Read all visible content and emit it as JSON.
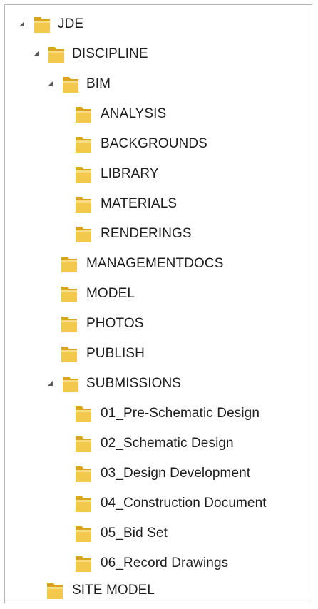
{
  "tree": {
    "items": [
      {
        "label": "JDE",
        "expanded": true,
        "icon": "folder-icon"
      },
      {
        "label": "DISCIPLINE",
        "expanded": true,
        "icon": "folder-icon"
      },
      {
        "label": "BIM",
        "expanded": true,
        "icon": "folder-icon"
      },
      {
        "label": "ANALYSIS",
        "icon": "folder-icon"
      },
      {
        "label": "BACKGROUNDS",
        "icon": "folder-icon"
      },
      {
        "label": "LIBRARY",
        "icon": "folder-icon"
      },
      {
        "label": "MATERIALS",
        "icon": "folder-icon"
      },
      {
        "label": "RENDERINGS",
        "icon": "folder-icon"
      },
      {
        "label": "MANAGEMENTDOCS",
        "icon": "folder-icon"
      },
      {
        "label": "MODEL",
        "icon": "folder-icon"
      },
      {
        "label": "PHOTOS",
        "icon": "folder-icon"
      },
      {
        "label": "PUBLISH",
        "icon": "folder-icon"
      },
      {
        "label": "SUBMISSIONS",
        "expanded": true,
        "icon": "folder-icon"
      },
      {
        "label": "01_Pre-Schematic Design",
        "icon": "folder-icon"
      },
      {
        "label": "02_Schematic Design",
        "icon": "folder-icon"
      },
      {
        "label": "03_Design Development",
        "icon": "folder-icon"
      },
      {
        "label": "04_Construction Document",
        "icon": "folder-icon"
      },
      {
        "label": "05_Bid Set",
        "icon": "folder-icon"
      },
      {
        "label": "06_Record Drawings",
        "icon": "folder-icon"
      },
      {
        "label": "SITE MODEL",
        "icon": "folder-icon"
      }
    ]
  },
  "colors": {
    "folder_front": "#f2c94c",
    "folder_back": "#d9a520",
    "arrow": "#5a5a5a",
    "text": "#1e1e1e",
    "border": "#b9b9b9"
  }
}
